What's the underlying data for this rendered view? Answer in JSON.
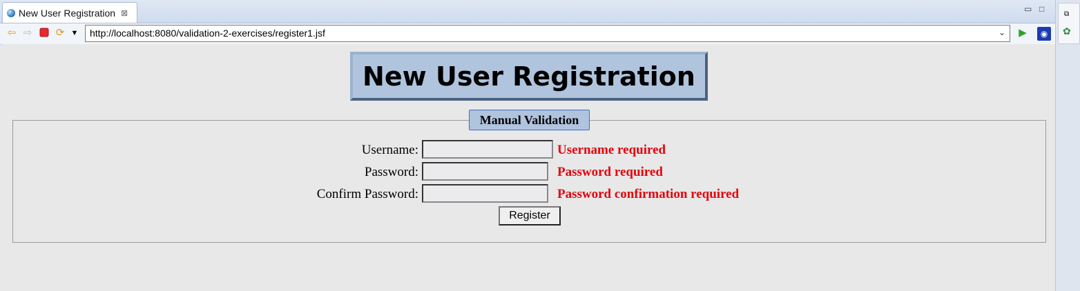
{
  "browser": {
    "tab_title": "New User Registration",
    "tab_close": "⊠",
    "url": "http://localhost:8080/validation-2-exercises/register1.jsf"
  },
  "page": {
    "heading": "New User Registration",
    "legend": "Manual Validation",
    "fields": [
      {
        "label": "Username:",
        "value": "",
        "error": "Username required"
      },
      {
        "label": "Password:",
        "value": "",
        "error": "Password required"
      },
      {
        "label": "Confirm Password:",
        "value": "",
        "error": "Password confirmation required"
      }
    ],
    "register_label": "Register"
  },
  "colors": {
    "heading_bg": "#b0c4de",
    "error": "#e8000a"
  }
}
